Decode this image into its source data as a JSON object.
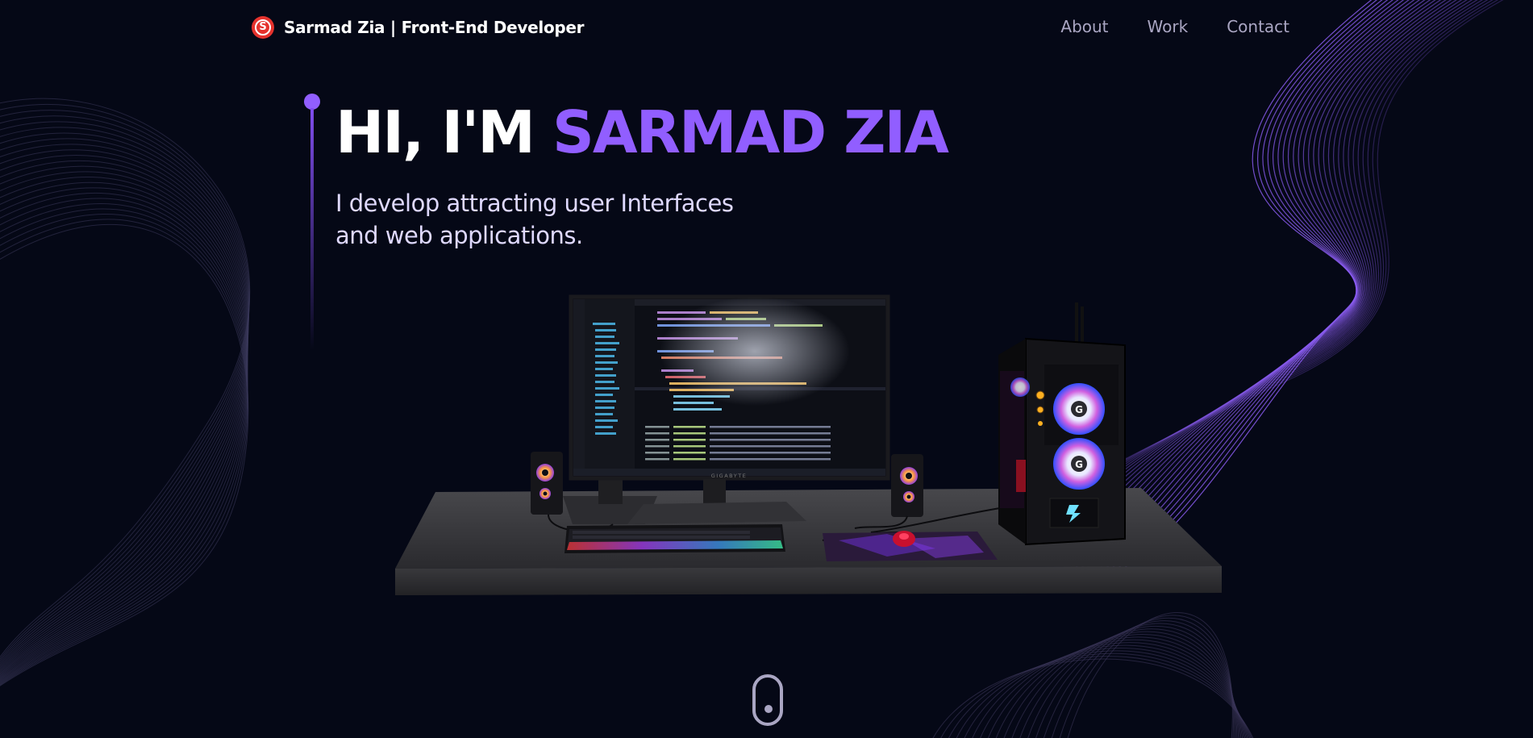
{
  "navbar": {
    "logo_letter": "S",
    "brand": "Sarmad Zia | Front-End Developer",
    "links": [
      "About",
      "Work",
      "Contact"
    ]
  },
  "hero": {
    "greeting": "HI, I'M ",
    "name": "SARMAD ZIA",
    "subtitle_line1": "I develop attracting user Interfaces",
    "subtitle_line2": "and web applications.",
    "monitor_brand": "GIGABYTE"
  },
  "colors": {
    "background": "#050816",
    "accent": "#915eff",
    "secondary_text": "#aaa6c3",
    "subtitle": "#dfd9ff",
    "logo_red": "#e5322d"
  },
  "icons": {
    "logo": "s-logo-icon",
    "scroll": "mouse-scroll-icon"
  }
}
